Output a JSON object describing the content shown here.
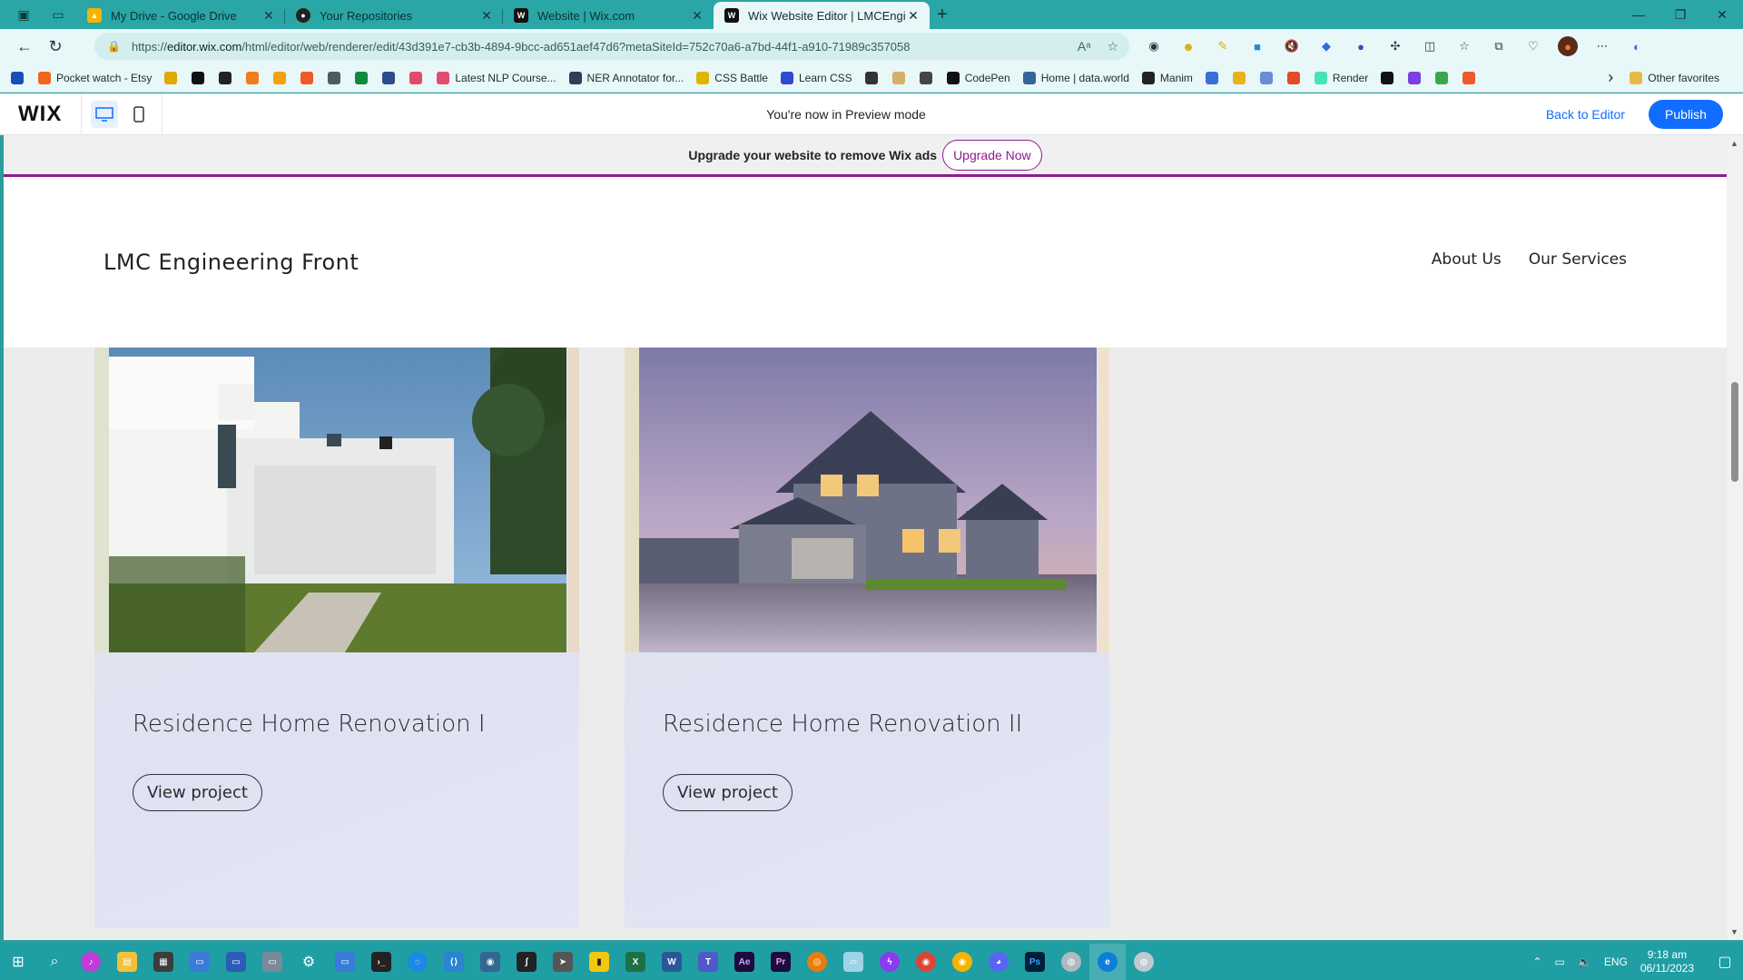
{
  "browser": {
    "tabs": [
      {
        "label": "My Drive - Google Drive",
        "favicon": "google-drive-icon",
        "color": "#f4b400"
      },
      {
        "label": "Your Repositories",
        "favicon": "github-icon",
        "color": "#222222"
      },
      {
        "label": "Website | Wix.com",
        "favicon": "wix-icon",
        "color": "#111111"
      },
      {
        "label": "Wix Website Editor | LMCEnginee",
        "favicon": "wix-icon",
        "color": "#111111",
        "active": true
      }
    ],
    "url_prefix": "https://",
    "url_domain": "editor.wix.com",
    "url_path": "/html/editor/web/renderer/edit/43d391e7-cb3b-4894-9bcc-ad651aef47d6?metaSiteId=752c70a6-a7bd-44f1-a910-71989c357058",
    "bookmarks": [
      {
        "label": "",
        "icon": "play-icon",
        "color": "#1a4dbb"
      },
      {
        "label": "Pocket watch - Etsy",
        "icon": "etsy-icon",
        "color": "#f1641e"
      },
      {
        "label": "",
        "icon": "bookmark-icon",
        "color": "#e0a800"
      },
      {
        "label": "",
        "icon": "amazon-icon",
        "color": "#111111"
      },
      {
        "label": "",
        "icon": "bookmark-icon",
        "color": "#222222"
      },
      {
        "label": "",
        "icon": "bookmark-icon",
        "color": "#f07c1c"
      },
      {
        "label": "",
        "icon": "bookmark-icon",
        "color": "#f5a00c"
      },
      {
        "label": "",
        "icon": "bookmark-icon",
        "color": "#ee5a2a"
      },
      {
        "label": "",
        "icon": "page-icon",
        "color": "#4f5b62"
      },
      {
        "label": "",
        "icon": "bookmark-icon",
        "color": "#0d8a3a"
      },
      {
        "label": "",
        "icon": "bookmark-icon",
        "color": "#2c4d8a"
      },
      {
        "label": "",
        "icon": "bookmark-icon",
        "color": "#e24b6d"
      },
      {
        "label": "Latest NLP Course...",
        "icon": "bookmark-icon",
        "color": "#e24b6d"
      },
      {
        "label": "NER Annotator for...",
        "icon": "bookmark-icon",
        "color": "#2e3d58"
      },
      {
        "label": "CSS Battle",
        "icon": "css-battle-icon",
        "color": "#e1b400"
      },
      {
        "label": "Learn CSS",
        "icon": "bookmark-icon",
        "color": "#2d4bd2"
      },
      {
        "label": "",
        "icon": "bookmark-icon",
        "color": "#333333"
      },
      {
        "label": "",
        "icon": "bookmark-icon",
        "color": "#d4b06a"
      },
      {
        "label": "",
        "icon": "bookmark-icon",
        "color": "#444444"
      },
      {
        "label": "CodePen",
        "icon": "codepen-icon",
        "color": "#111111"
      },
      {
        "label": "Home | data.world",
        "icon": "bookmark-icon",
        "color": "#336699"
      },
      {
        "label": "Manim",
        "icon": "bookmark-icon",
        "color": "#222222"
      },
      {
        "label": "",
        "icon": "bookmark-icon",
        "color": "#3a6fd8"
      },
      {
        "label": "",
        "icon": "bookmark-icon",
        "color": "#e8b21a"
      },
      {
        "label": "",
        "icon": "bookmark-icon",
        "color": "#6a8bd6"
      },
      {
        "label": "",
        "icon": "bookmark-icon",
        "color": "#e24a2a"
      },
      {
        "label": "Render",
        "icon": "bookmark-icon",
        "color": "#46e3b7"
      },
      {
        "label": "",
        "icon": "bookmark-icon",
        "color": "#111111"
      },
      {
        "label": "",
        "icon": "bookmark-icon",
        "color": "#7b3fe4"
      },
      {
        "label": "",
        "icon": "bookmark-icon",
        "color": "#3aa84a"
      },
      {
        "label": "",
        "icon": "bookmark-icon",
        "color": "#ee5a2a"
      }
    ],
    "other_favorites": "Other favorites"
  },
  "wix_bar": {
    "logo": "WIX",
    "preview_message": "You're now in Preview mode",
    "back_to_editor": "Back to Editor",
    "publish": "Publish"
  },
  "ad_bar": {
    "message": "Upgrade your website to remove Wix ads",
    "button": "Upgrade Now"
  },
  "site": {
    "title": "LMC Engineering Front",
    "nav": [
      "About Us",
      "Our Services"
    ],
    "projects": [
      {
        "title": "Residence Home Renovation I",
        "button": "View project"
      },
      {
        "title": "Residence Home Renovation II",
        "button": "View project"
      }
    ]
  },
  "taskbar": {
    "language": "ENG",
    "time": "9:18 am",
    "date": "06/11/2023"
  },
  "colors": {
    "browser_accent": "#2aa6a6",
    "wix_blue": "#116dff",
    "ad_purple": "#8e1b8e"
  }
}
